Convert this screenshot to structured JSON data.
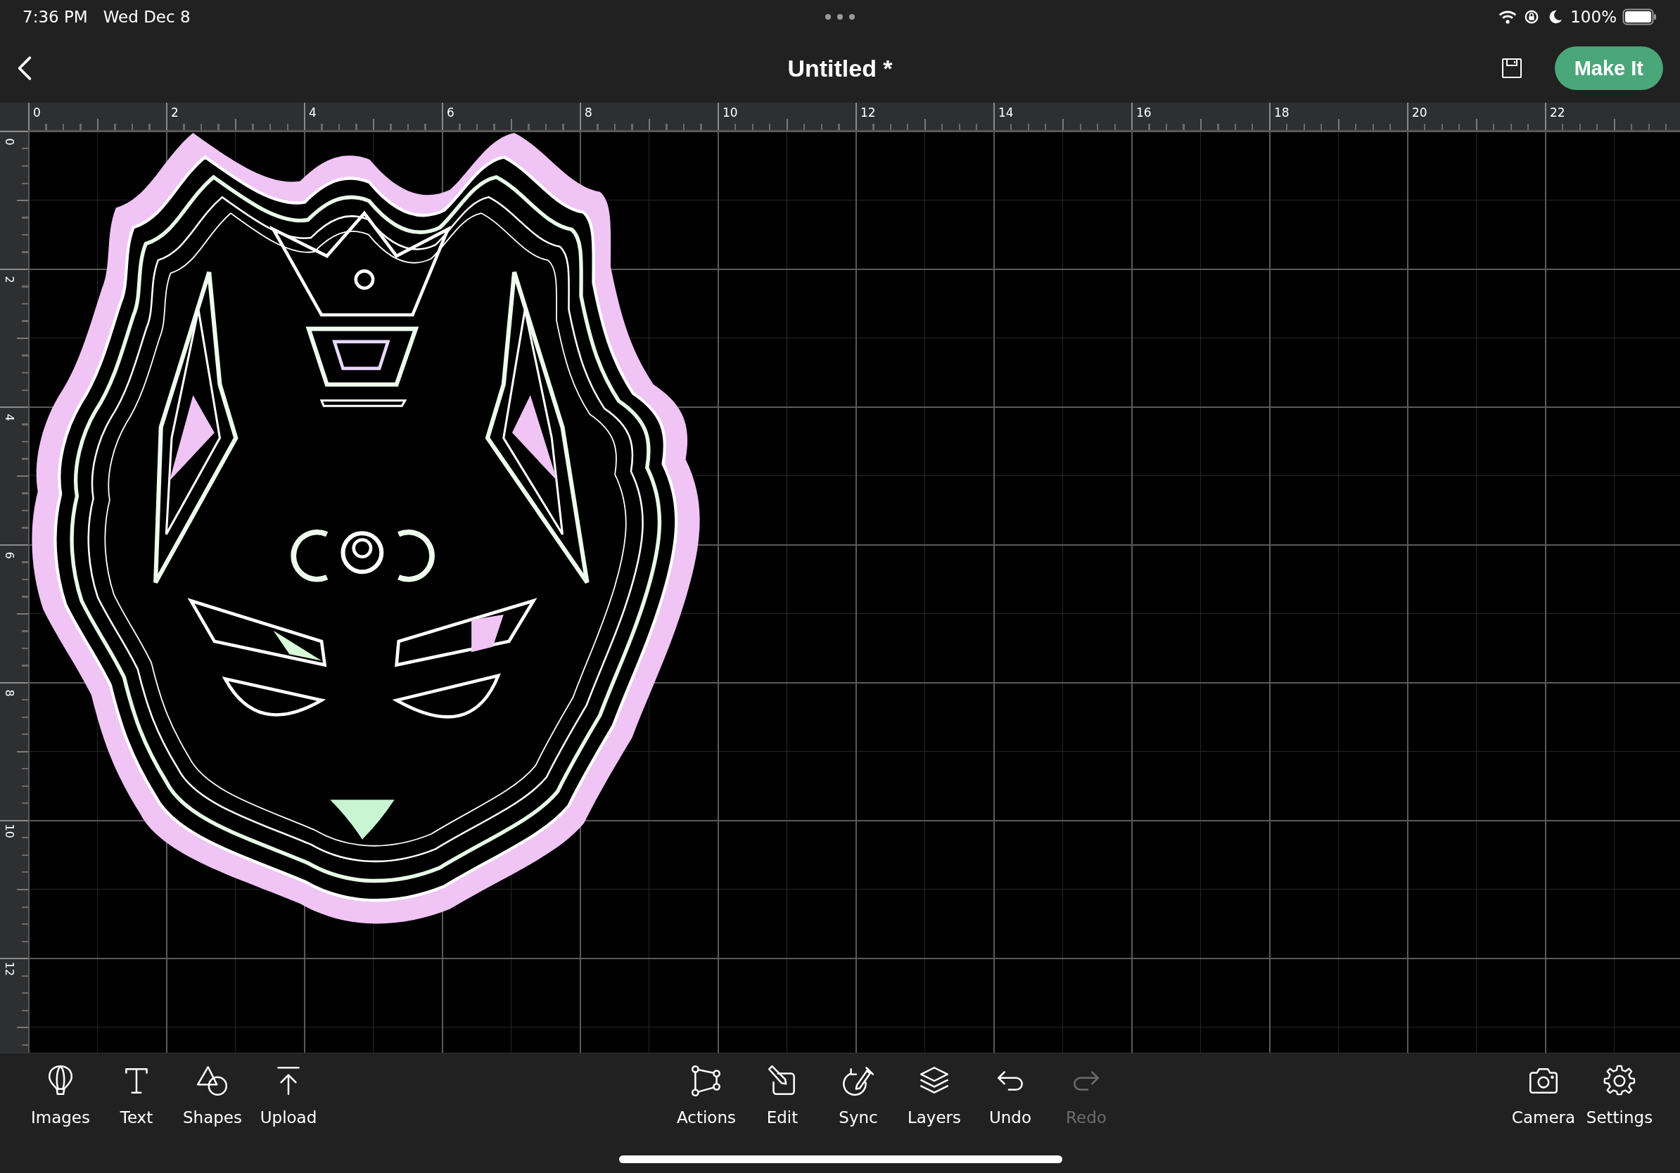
{
  "status_bar": {
    "time": "7:36 PM",
    "date": "Wed Dec 8",
    "battery": "100%"
  },
  "header": {
    "title": "Untitled *",
    "make_button": "Make It"
  },
  "rulers": {
    "horizontal": [
      "0",
      "2",
      "4",
      "6",
      "8",
      "10",
      "12",
      "14",
      "16",
      "18",
      "20",
      "22"
    ],
    "vertical": [
      "0",
      "2",
      "4",
      "6",
      "8",
      "10",
      "12"
    ]
  },
  "toolbar": {
    "left": [
      {
        "label": "Images",
        "disabled": false
      },
      {
        "label": "Text",
        "disabled": false
      },
      {
        "label": "Shapes",
        "disabled": false
      },
      {
        "label": "Upload",
        "disabled": false
      }
    ],
    "center": [
      {
        "label": "Actions",
        "disabled": false
      },
      {
        "label": "Edit",
        "disabled": false
      },
      {
        "label": "Sync",
        "disabled": false
      },
      {
        "label": "Layers",
        "disabled": false
      },
      {
        "label": "Undo",
        "disabled": false
      },
      {
        "label": "Redo",
        "disabled": true
      }
    ],
    "right": [
      {
        "label": "Camera",
        "disabled": false
      },
      {
        "label": "Settings",
        "disabled": false
      }
    ]
  }
}
